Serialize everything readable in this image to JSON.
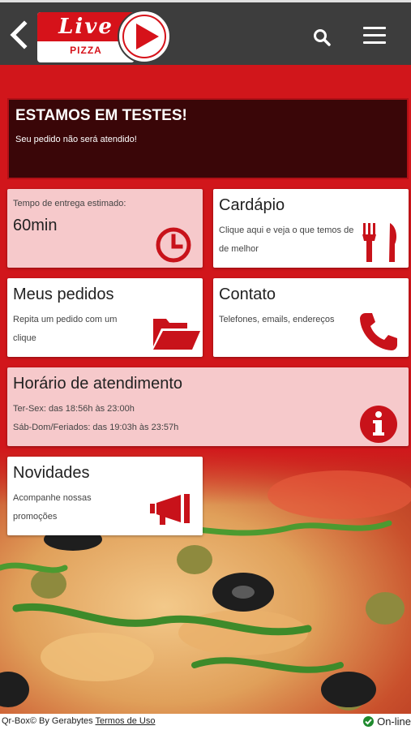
{
  "header": {
    "logo_text": "Live",
    "logo_sub": "PIZZA"
  },
  "banner": {
    "title": "ESTAMOS EM TESTES!",
    "subtitle": "Seu pedido não será atendido!"
  },
  "tiles": {
    "delivery": {
      "label": "Tempo de entrega estimado:",
      "value": "60min"
    },
    "menu": {
      "title": "Cardápio",
      "line1": "Clique aqui e veja o que temos de",
      "line2": "de melhor"
    },
    "orders": {
      "title": "Meus pedidos",
      "line1": "Repita um pedido com um",
      "line2": "clique"
    },
    "contact": {
      "title": "Contato",
      "line1": "Telefones, emails, endereços"
    },
    "hours": {
      "title": "Horário de atendimento",
      "line1": "Ter-Sex: das 18:56h às 23:00h",
      "line2": "Sáb-Dom/Feriados: das 19:03h às 23:57h"
    },
    "news": {
      "title": "Novidades",
      "line1": "Acompanhe nossas",
      "line2": "promoções"
    }
  },
  "footer": {
    "credit": "Qr-Box© By Gerabytes",
    "terms": "Termos de Uso",
    "status": "On-line"
  },
  "colors": {
    "brand": "#d6121a",
    "header": "#3d3d3d",
    "status": "#1f8a2e"
  }
}
